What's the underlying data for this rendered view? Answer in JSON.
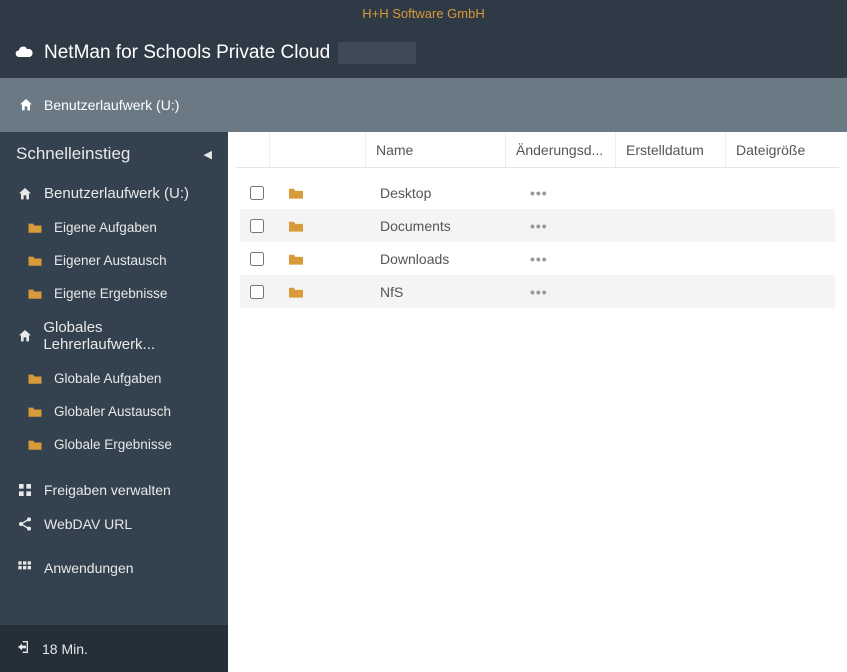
{
  "topbar": {
    "company": "H+H Software GmbH"
  },
  "header": {
    "title": "NetMan for Schools Private Cloud"
  },
  "breadcrumb": {
    "path": "Benutzerlaufwerk (U:)"
  },
  "sidebar": {
    "heading": "Schnelleinstieg",
    "groups": [
      {
        "label": "Benutzerlaufwerk (U:)",
        "icon": "home",
        "children": [
          {
            "label": "Eigene Aufgaben"
          },
          {
            "label": "Eigener Austausch"
          },
          {
            "label": "Eigene Ergebnisse"
          }
        ]
      },
      {
        "label": "Globales Lehrerlaufwerk...",
        "icon": "home",
        "children": [
          {
            "label": "Globale Aufgaben"
          },
          {
            "label": "Globaler Austausch"
          },
          {
            "label": "Globale Ergebnisse"
          }
        ]
      }
    ],
    "tools": [
      {
        "label": "Freigaben verwalten",
        "icon": "shares"
      },
      {
        "label": "WebDAV URL",
        "icon": "share-nodes"
      },
      {
        "label": "Anwendungen",
        "icon": "grid"
      }
    ],
    "logout": {
      "label": "18 Min."
    }
  },
  "table": {
    "headers": {
      "name": "Name",
      "modified": "Änderungsd...",
      "created": "Erstelldatum",
      "size": "Dateigröße"
    },
    "rows": [
      {
        "name": "Desktop"
      },
      {
        "name": "Documents"
      },
      {
        "name": "Downloads"
      },
      {
        "name": "NfS"
      }
    ]
  }
}
